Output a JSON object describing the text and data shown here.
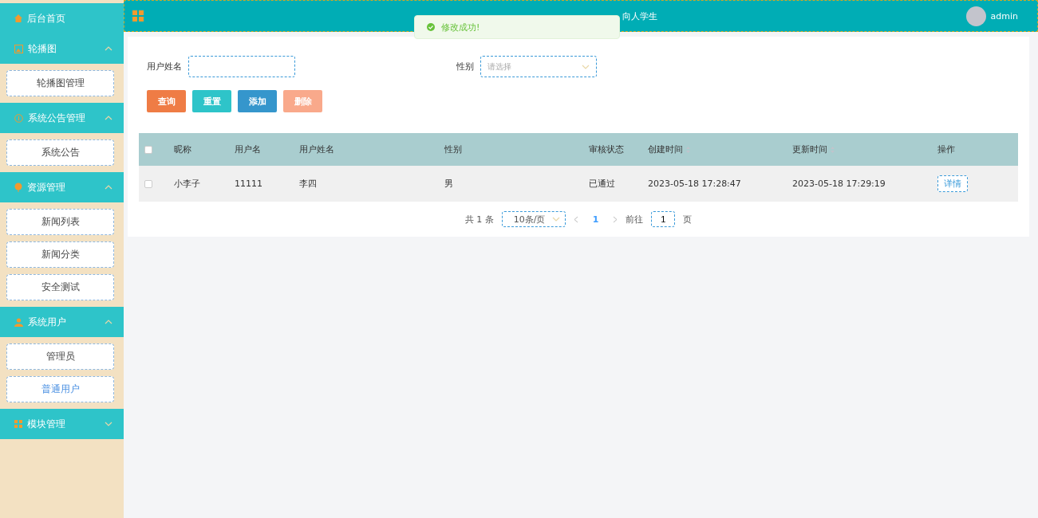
{
  "sidebar": {
    "home": {
      "label": "后台首页"
    },
    "groups": [
      {
        "label": "轮播图",
        "expanded": true,
        "items": [
          {
            "label": "轮播图管理",
            "selected": false
          }
        ]
      },
      {
        "label": "系统公告管理",
        "expanded": true,
        "items": [
          {
            "label": "系统公告",
            "selected": false
          }
        ]
      },
      {
        "label": "资源管理",
        "expanded": true,
        "items": [
          {
            "label": "新闻列表",
            "selected": false
          },
          {
            "label": "新闻分类",
            "selected": false
          },
          {
            "label": "安全测试",
            "selected": false
          }
        ]
      },
      {
        "label": "系统用户",
        "expanded": true,
        "items": [
          {
            "label": "管理员",
            "selected": false
          },
          {
            "label": "普通用户",
            "selected": true
          }
        ]
      },
      {
        "label": "模块管理",
        "expanded": false
      }
    ]
  },
  "header": {
    "title": "向人学生",
    "user": "admin"
  },
  "toast": {
    "message": "修改成功!"
  },
  "filters": [
    {
      "label": "用户姓名",
      "kind": "input"
    },
    {
      "label": "性别",
      "kind": "select",
      "placeholder": "请选择"
    }
  ],
  "buttons": [
    {
      "label": "查询",
      "color": "#ef7c45"
    },
    {
      "label": "重置",
      "color": "#2ec4c9"
    },
    {
      "label": "添加",
      "color": "#3596cc"
    },
    {
      "label": "删除",
      "color": "#f9a98b"
    }
  ],
  "table": {
    "columns": [
      {
        "label": "昵称",
        "sortable": false
      },
      {
        "label": "用户名",
        "sortable": false
      },
      {
        "label": "用户姓名",
        "sortable": false
      },
      {
        "label": "性别",
        "sortable": false
      },
      {
        "label": "审核状态",
        "sortable": false
      },
      {
        "label": "创建时间",
        "sortable": true
      },
      {
        "label": "更新时间",
        "sortable": true
      },
      {
        "label": "操作",
        "sortable": false
      }
    ],
    "all_checked": false,
    "rows": [
      {
        "checked": false,
        "cells": [
          "小李子",
          "11111",
          "李四",
          "男",
          "已通过",
          "2023-05-18 17:28:47",
          "2023-05-18 17:29:19"
        ],
        "action": "详情"
      }
    ]
  },
  "pagination": {
    "total": "共 1 条",
    "page_size": "10条/页",
    "pages": [
      {
        "label": "1",
        "selected": true
      }
    ],
    "goto_label": "前往",
    "goto_value": "1",
    "goto_suffix": "页"
  }
}
